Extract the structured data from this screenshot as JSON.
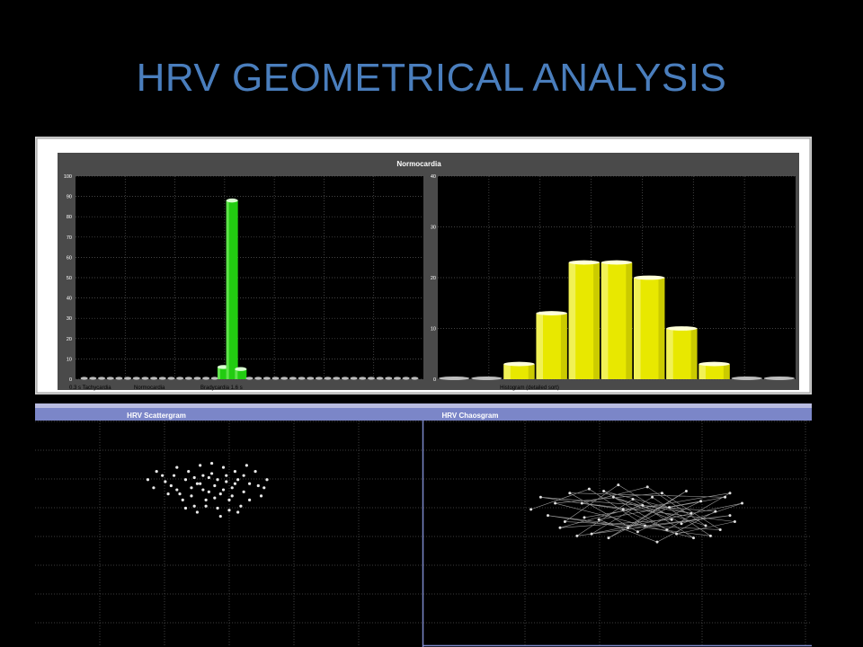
{
  "slide": {
    "title": "HRV GEOMETRICAL ANALYSIS"
  },
  "colors": {
    "title": "#4a7ebd",
    "green_bar": "#22cc11",
    "yellow_bar": "#e8e800",
    "panel_header": "#7b86c8",
    "grid": "#5a5a5a"
  },
  "top_panel": {
    "header": "Normocardia",
    "left_xlabels": [
      "0.3 s Tachycardia",
      "Normocardia",
      "Bradycardia 1.6 s"
    ],
    "right_xlabel": "Histogram (detailed sort)"
  },
  "bottom_panel": {
    "left_header": "HRV Scattergram",
    "right_header": "HRV Chaosgram"
  },
  "chart_data": [
    {
      "type": "bar",
      "title": "Normocardia",
      "xlabel": "",
      "ylabel": "",
      "ylim": [
        0,
        100
      ],
      "yticks": [
        0,
        10,
        20,
        30,
        40,
        50,
        60,
        70,
        80,
        90,
        100
      ],
      "values": [
        0,
        0,
        0,
        0,
        0,
        0,
        0,
        0,
        0,
        0,
        0,
        0,
        0,
        0,
        0,
        0,
        0,
        0,
        0,
        0,
        0,
        0,
        0,
        0,
        0,
        0,
        0,
        0,
        0,
        0,
        0,
        0,
        0,
        0,
        0,
        0,
        0,
        0,
        0
      ],
      "category_labels": [
        "0.3 s Tachycardia",
        "Normocardia",
        "Bradycardia 1.6 s"
      ],
      "color": "#22cc11",
      "highlight": [
        {
          "index": 16,
          "value": 6
        },
        {
          "index": 17,
          "value": 88
        },
        {
          "index": 18,
          "value": 5
        }
      ]
    },
    {
      "type": "bar",
      "title": "Histogram (detailed sort)",
      "ylim": [
        0,
        40
      ],
      "yticks": [
        0,
        10,
        20,
        30,
        40
      ],
      "values": [
        0,
        0,
        3,
        13,
        23,
        23,
        20,
        10,
        3,
        0,
        0
      ],
      "color": "#e8e800"
    },
    {
      "type": "scatter",
      "title": "HRV Scattergram",
      "points": [
        [
          0.51,
          0.59
        ],
        [
          0.53,
          0.57
        ],
        [
          0.55,
          0.55
        ],
        [
          0.58,
          0.6
        ],
        [
          0.6,
          0.52
        ],
        [
          0.62,
          0.58
        ],
        [
          0.64,
          0.55
        ],
        [
          0.66,
          0.61
        ],
        [
          0.68,
          0.57
        ],
        [
          0.7,
          0.53
        ],
        [
          0.72,
          0.59
        ],
        [
          0.74,
          0.56
        ],
        [
          0.76,
          0.6
        ],
        [
          0.78,
          0.54
        ],
        [
          0.8,
          0.58
        ],
        [
          0.57,
          0.5
        ],
        [
          0.61,
          0.47
        ],
        [
          0.65,
          0.5
        ],
        [
          0.69,
          0.46
        ],
        [
          0.73,
          0.5
        ],
        [
          0.77,
          0.47
        ],
        [
          0.59,
          0.64
        ],
        [
          0.63,
          0.67
        ],
        [
          0.67,
          0.63
        ],
        [
          0.71,
          0.66
        ],
        [
          0.75,
          0.64
        ],
        [
          0.79,
          0.67
        ],
        [
          0.55,
          0.66
        ],
        [
          0.5,
          0.62
        ],
        [
          0.47,
          0.56
        ],
        [
          0.45,
          0.6
        ],
        [
          0.83,
          0.57
        ],
        [
          0.86,
          0.6
        ],
        [
          0.84,
          0.52
        ],
        [
          0.62,
          0.44
        ],
        [
          0.7,
          0.42
        ],
        [
          0.66,
          0.54
        ],
        [
          0.72,
          0.62
        ],
        [
          0.6,
          0.56
        ],
        [
          0.64,
          0.62
        ],
        [
          0.68,
          0.51
        ],
        [
          0.74,
          0.52
        ],
        [
          0.78,
          0.62
        ],
        [
          0.56,
          0.53
        ],
        [
          0.82,
          0.64
        ],
        [
          0.52,
          0.53
        ],
        [
          0.58,
          0.46
        ],
        [
          0.76,
          0.44
        ],
        [
          0.8,
          0.5
        ],
        [
          0.67,
          0.68
        ],
        [
          0.63,
          0.58
        ],
        [
          0.71,
          0.55
        ],
        [
          0.69,
          0.6
        ],
        [
          0.61,
          0.61
        ],
        [
          0.75,
          0.58
        ],
        [
          0.85,
          0.56
        ],
        [
          0.48,
          0.64
        ],
        [
          0.54,
          0.62
        ],
        [
          0.73,
          0.45
        ],
        [
          0.65,
          0.47
        ]
      ]
    },
    {
      "type": "line",
      "title": "HRV Chaosgram",
      "points": [
        [
          0.08,
          0.52
        ],
        [
          0.32,
          0.62
        ],
        [
          0.55,
          0.44
        ],
        [
          0.9,
          0.49
        ],
        [
          0.27,
          0.39
        ],
        [
          0.5,
          0.57
        ],
        [
          0.75,
          0.38
        ],
        [
          0.18,
          0.55
        ],
        [
          0.62,
          0.6
        ],
        [
          0.86,
          0.42
        ],
        [
          0.22,
          0.46
        ],
        [
          0.44,
          0.64
        ],
        [
          0.7,
          0.45
        ],
        [
          0.95,
          0.55
        ],
        [
          0.33,
          0.4
        ],
        [
          0.58,
          0.58
        ],
        [
          0.82,
          0.39
        ],
        [
          0.15,
          0.49
        ],
        [
          0.48,
          0.43
        ],
        [
          0.72,
          0.61
        ],
        [
          0.4,
          0.38
        ],
        [
          0.65,
          0.53
        ],
        [
          0.88,
          0.58
        ],
        [
          0.24,
          0.6
        ],
        [
          0.52,
          0.41
        ],
        [
          0.78,
          0.56
        ],
        [
          0.36,
          0.47
        ],
        [
          0.6,
          0.36
        ],
        [
          0.84,
          0.51
        ],
        [
          0.12,
          0.58
        ],
        [
          0.46,
          0.52
        ],
        [
          0.68,
          0.4
        ],
        [
          0.92,
          0.46
        ],
        [
          0.29,
          0.55
        ],
        [
          0.56,
          0.63
        ],
        [
          0.8,
          0.44
        ],
        [
          0.42,
          0.58
        ],
        [
          0.66,
          0.47
        ],
        [
          0.2,
          0.43
        ],
        [
          0.54,
          0.54
        ],
        [
          0.74,
          0.5
        ],
        [
          0.38,
          0.61
        ],
        [
          0.64,
          0.42
        ],
        [
          0.9,
          0.6
        ],
        [
          0.3,
          0.48
        ]
      ]
    }
  ]
}
